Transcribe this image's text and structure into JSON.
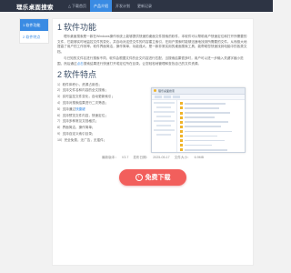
{
  "header": {
    "logo": "理乐桌面搜索",
    "nav": [
      {
        "label": "△ 下载首页",
        "active": false
      },
      {
        "label": "产品介绍",
        "active": true
      },
      {
        "label": "开发计划",
        "active": false
      },
      {
        "label": "更新记录",
        "active": false
      }
    ]
  },
  "sidebar": {
    "items": [
      {
        "label": "1 软件功能",
        "active": true
      },
      {
        "label": "2 软件特点",
        "active": false
      }
    ]
  },
  "section1": {
    "num": "1",
    "title": "软件功能",
    "para1": "理乐桌面搜索是一款在Windows操作系统上能够提供快速的桌面文件搜索的软件，本软件可以帮助用户快速定位和打开所需要的文件，它能够实时地监控文件的变化，并自动对这些文件的内容建立索引，在用户搜索时能够迅速地找到所需要的文件。从而极大地提高了用户的工作效率。软件界面简洁，操作简单，功能强大，是一款非常实用的桌面搜索工具，能帮助您快速找到电脑中的各类文档。",
    "para2_before": "与已知的文件名进行搜索不同，软件会根据文件的全文内容进行匹配，当搜索结果很多时，用户可以进一步输入关键字缩小范围，然后通过",
    "para2_link": "点击",
    "para2_after": "搜索结果进行快速打开或定位所在目录。让您轻松地管理和查找自己的文件资源。"
  },
  "section2": {
    "num": "2",
    "title": "软件特点",
    "features": [
      "1）软件体积小，资源占用低；",
      "2）支持文件名和内容的全文搜索；",
      "3）实时监控文件变化，自动更新索引；",
      "4）支持对搜索结果进行二次筛选；",
      "5）支持通过",
      "6）支持预览文件内容，快速定位；",
      "7）支持多种常见文档格式；",
      "8）界面简洁，操作简单；",
      "9）支持自定义索引目录；",
      "10）完全免费，无广告，无插件；"
    ],
    "feature_link": "快捷键"
  },
  "screenshot": {
    "title": "理乐桌面搜索"
  },
  "meta": {
    "size_label": "最新版本：",
    "size_value": "V3.7",
    "date_label": "发布日期：",
    "date_value": "2025-05-17",
    "filesize_label": "文件大小：",
    "filesize_value": "6.9MB"
  },
  "download": {
    "label": "免费下载"
  },
  "colors": {
    "header": "#2d3444",
    "accent": "#3a8be3",
    "download": "#f25f5c"
  }
}
